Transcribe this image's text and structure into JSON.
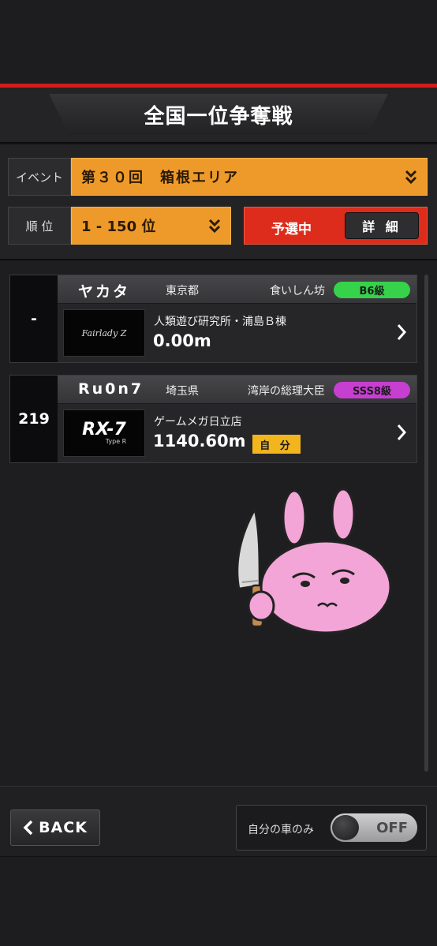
{
  "header": {
    "title": "全国一位争奪戦"
  },
  "filters": {
    "event_label": "イベント",
    "event_value": "第３０回　箱根エリア",
    "rank_label": "順 位",
    "rank_value": "1 - 150 位",
    "status": "予選中",
    "detail_button": "詳 細"
  },
  "entries": [
    {
      "rank": "-",
      "name": "ヤカタ",
      "prefecture": "東京都",
      "title": "食いしん坊",
      "grade": "B6級",
      "grade_color": "#35d24a",
      "car_logo": "Fairlady Z",
      "shop": "人類遊び研究所・浦島Ｂ棟",
      "distance": "0.00m"
    },
    {
      "rank": "219",
      "name": "Ru0n7",
      "prefecture": "埼玉県",
      "title": "湾岸の総理大臣",
      "grade": "SSS8級",
      "grade_color": "#c63fd0",
      "car_logo": "RX-7",
      "car_logo_sub": "Type R",
      "shop": "ゲームメガ日立店",
      "distance": "1140.60m",
      "badge": "自 分"
    }
  ],
  "bottom": {
    "back_label": "BACK",
    "toggle_label": "自分の車のみ",
    "toggle_state": "OFF"
  },
  "colors": {
    "accent_red": "#d51b1b",
    "select_orange": "#ee9a2a",
    "status_red": "#dd2c1c",
    "self_badge": "#f2b51d"
  },
  "icons": [
    "chevron-double-down-icon",
    "chevron-right-icon",
    "chevron-left-icon",
    "rabbit-knife-sticker"
  ]
}
